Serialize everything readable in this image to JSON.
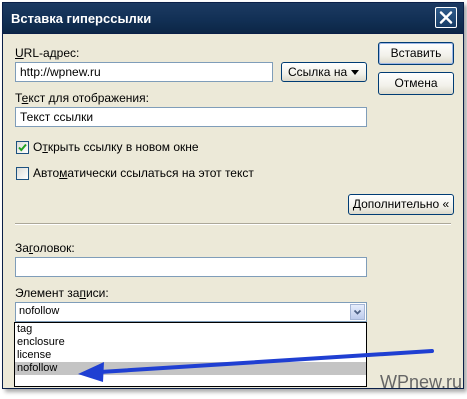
{
  "window": {
    "title": "Вставка гиперссылки"
  },
  "form": {
    "url_label_underlined": "U",
    "url_label_rest": "RL-адрес:",
    "url_value": "http://wpnew.ru",
    "link_dropdown_label": "Ссылка на",
    "display_text_label_start": "Т",
    "display_text_label_underlined": "е",
    "display_text_label_rest": "кст для отображения:",
    "display_text_value": "Текст ссылки",
    "open_new_window_start": "О",
    "open_new_window_underlined": "т",
    "open_new_window_rest": "крыть ссылку в новом окне",
    "open_new_window_checked": true,
    "auto_link_start": "Авто",
    "auto_link_underlined": "м",
    "auto_link_rest": "атически ссылаться на этот текст",
    "auto_link_checked": false,
    "advanced_button": "Дополнительно «",
    "heading_label_start": "За",
    "heading_label_underlined": "г",
    "heading_label_rest": "оловок:",
    "heading_value": "",
    "record_element_label_start": "Элемент за",
    "record_element_label_underlined": "п",
    "record_element_label_rest": "иси:",
    "record_element_selected": "nofollow",
    "record_element_options": [
      "tag",
      "enclosure",
      "license",
      "nofollow"
    ]
  },
  "buttons": {
    "insert": "Вставить",
    "cancel": "Отмена"
  },
  "watermark": "WPnew.ru",
  "colors": {
    "titlebar": "#123055",
    "dialog_bg": "#ece9d8",
    "arrow": "#1f3fd2",
    "selected_option_bg": "#c4c4c4"
  },
  "icons": {
    "close": "close-icon",
    "check": "checkmark-icon",
    "dropdown": "chevron-down-icon",
    "annotation": "blue-arrow-icon"
  }
}
